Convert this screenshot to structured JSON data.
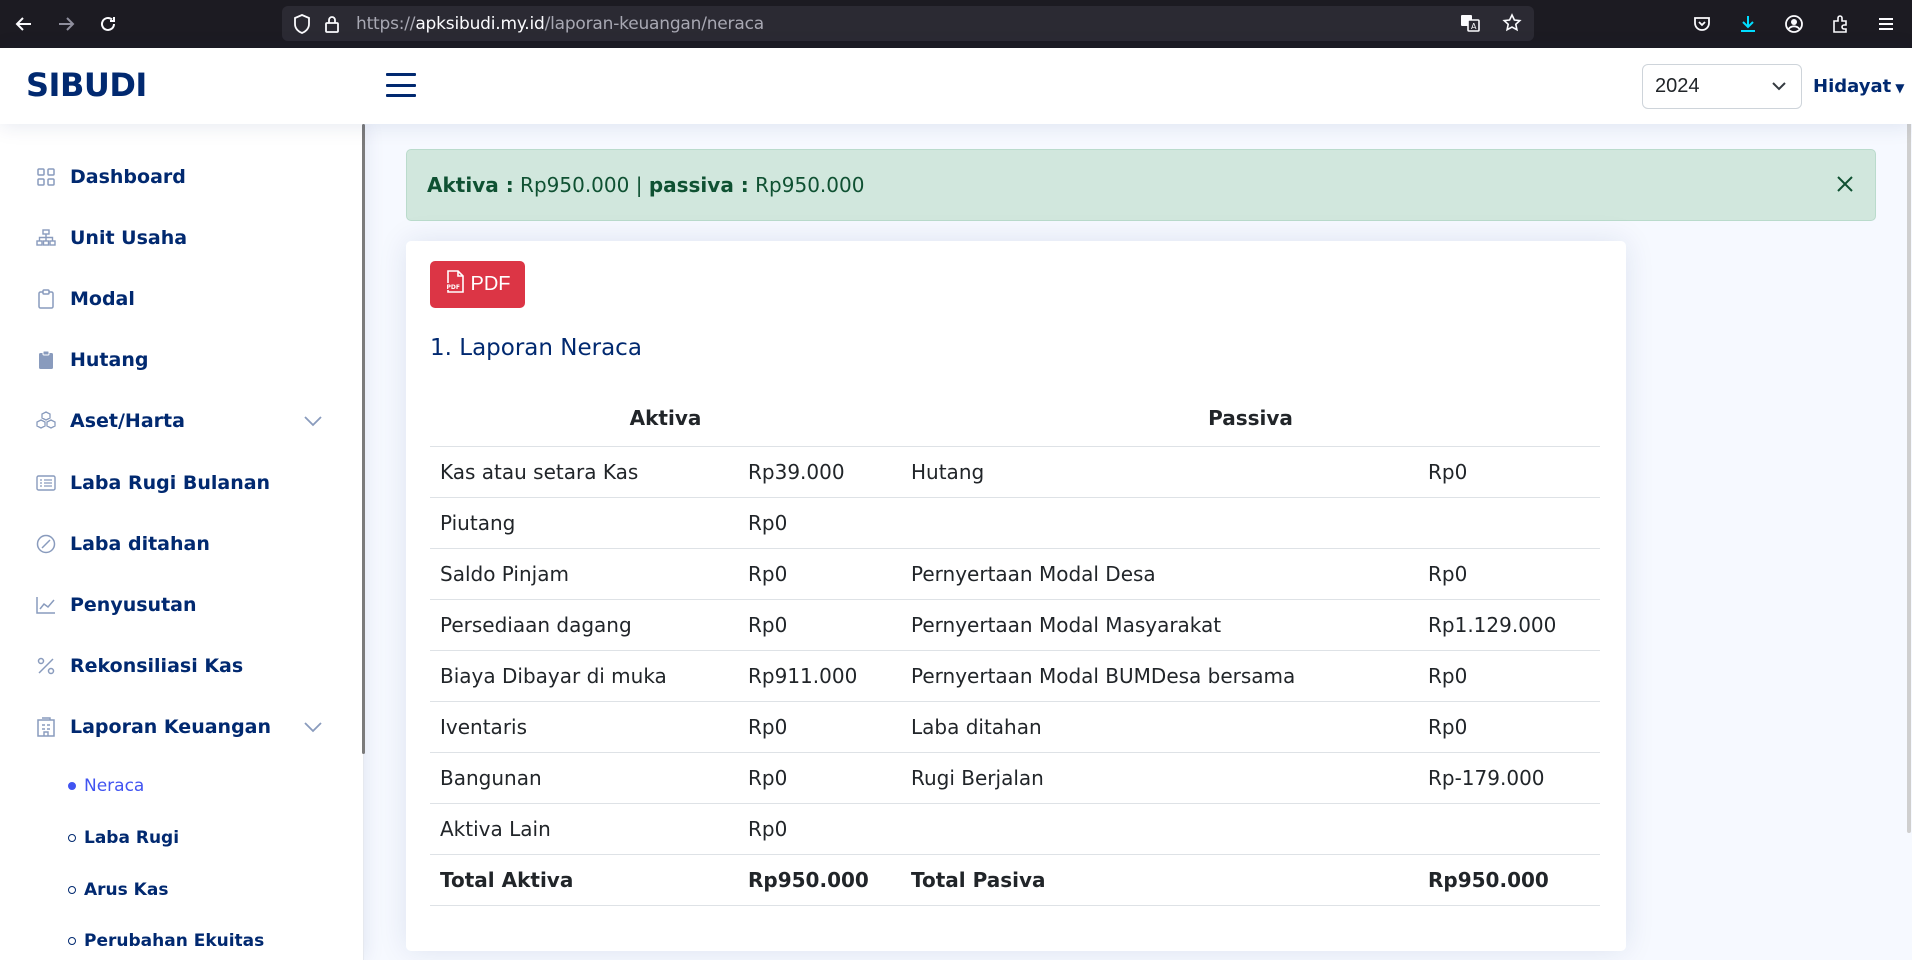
{
  "browser": {
    "url_scheme": "https://",
    "url_host": "apksibudi.my.id",
    "url_path": "/laporan-keuangan/neraca"
  },
  "header": {
    "logo": "SIBUDI",
    "year": "2024",
    "user": "Hidayat"
  },
  "sidebar": {
    "items": [
      {
        "label": "Dashboard",
        "icon": "grid-icon"
      },
      {
        "label": "Unit Usaha",
        "icon": "diagram-icon"
      },
      {
        "label": "Modal",
        "icon": "clipboard-icon"
      },
      {
        "label": "Hutang",
        "icon": "clipboard-filled-icon"
      },
      {
        "label": "Aset/Harta",
        "icon": "boxes-icon"
      },
      {
        "label": "Laba Rugi Bulanan",
        "icon": "card-list-icon"
      },
      {
        "label": "Laba ditahan",
        "icon": "slash-circle-icon"
      },
      {
        "label": "Penyusutan",
        "icon": "graph-icon"
      },
      {
        "label": "Rekonsiliasi Kas",
        "icon": "percent-icon"
      },
      {
        "label": "Laporan Keuangan",
        "icon": "building-icon"
      }
    ],
    "sub_items": [
      "Neraca",
      "Laba Rugi",
      "Arus Kas",
      "Perubahan Ekuitas"
    ]
  },
  "alert": {
    "aktiva_label": "Aktiva :",
    "aktiva_value": " Rp950.000 | ",
    "passiva_label": "passiva :",
    "passiva_value": " Rp950.000"
  },
  "card": {
    "pdf_label": "PDF",
    "title": "1. Laporan Neraca",
    "headers": {
      "aktiva": "Aktiva",
      "passiva": "Passiva"
    },
    "rows": [
      [
        "Kas atau setara Kas",
        "Rp39.000",
        "Hutang",
        "Rp0"
      ],
      [
        "Piutang",
        "Rp0",
        "",
        ""
      ],
      [
        "Saldo Pinjam",
        "Rp0",
        "Pernyertaan Modal Desa",
        "Rp0"
      ],
      [
        "Persediaan dagang",
        "Rp0",
        "Pernyertaan Modal Masyarakat",
        "Rp1.129.000"
      ],
      [
        "Biaya Dibayar di muka",
        "Rp911.000",
        "Pernyertaan Modal BUMDesa bersama",
        "Rp0"
      ],
      [
        "Iventaris",
        "Rp0",
        "Laba ditahan",
        "Rp0"
      ],
      [
        "Bangunan",
        "Rp0",
        "Rugi Berjalan",
        "Rp-179.000"
      ],
      [
        "Aktiva Lain",
        "Rp0",
        "",
        ""
      ]
    ],
    "total": [
      "Total Aktiva",
      "Rp950.000",
      "Total Pasiva",
      "Rp950.000"
    ]
  }
}
